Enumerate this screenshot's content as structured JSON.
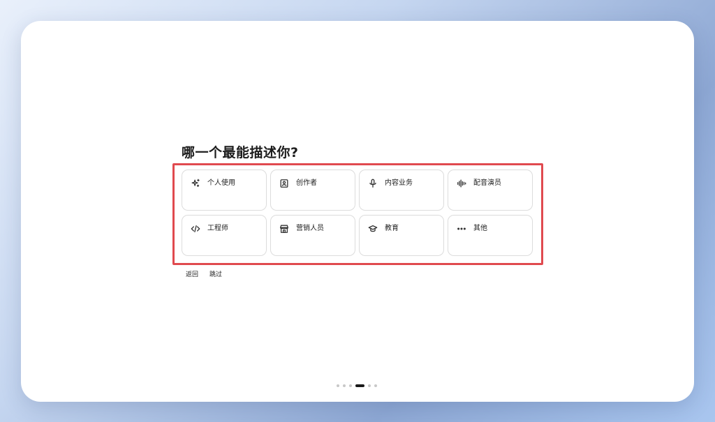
{
  "page": {
    "question": "哪一个最能描述你?"
  },
  "options": [
    {
      "label": "个人使用",
      "icon": "sparkles-icon"
    },
    {
      "label": "创作者",
      "icon": "portrait-frame-icon"
    },
    {
      "label": "内容业务",
      "icon": "microphone-icon"
    },
    {
      "label": "配音演员",
      "icon": "audio-waveform-icon"
    },
    {
      "label": "工程师",
      "icon": "code-icon"
    },
    {
      "label": "营销人员",
      "icon": "storefront-icon"
    },
    {
      "label": "教育",
      "icon": "graduation-cap-icon"
    },
    {
      "label": "其他",
      "icon": "more-dots-icon"
    }
  ],
  "nav": {
    "back_label": "返回",
    "skip_label": "跳过"
  },
  "pagination": {
    "total": 6,
    "current": 4
  },
  "colors": {
    "highlight_border": "#e04a4f",
    "card_border": "#dcdcdc",
    "active_dot": "#1a1a1a",
    "inactive_dot": "#c8c8c8"
  }
}
